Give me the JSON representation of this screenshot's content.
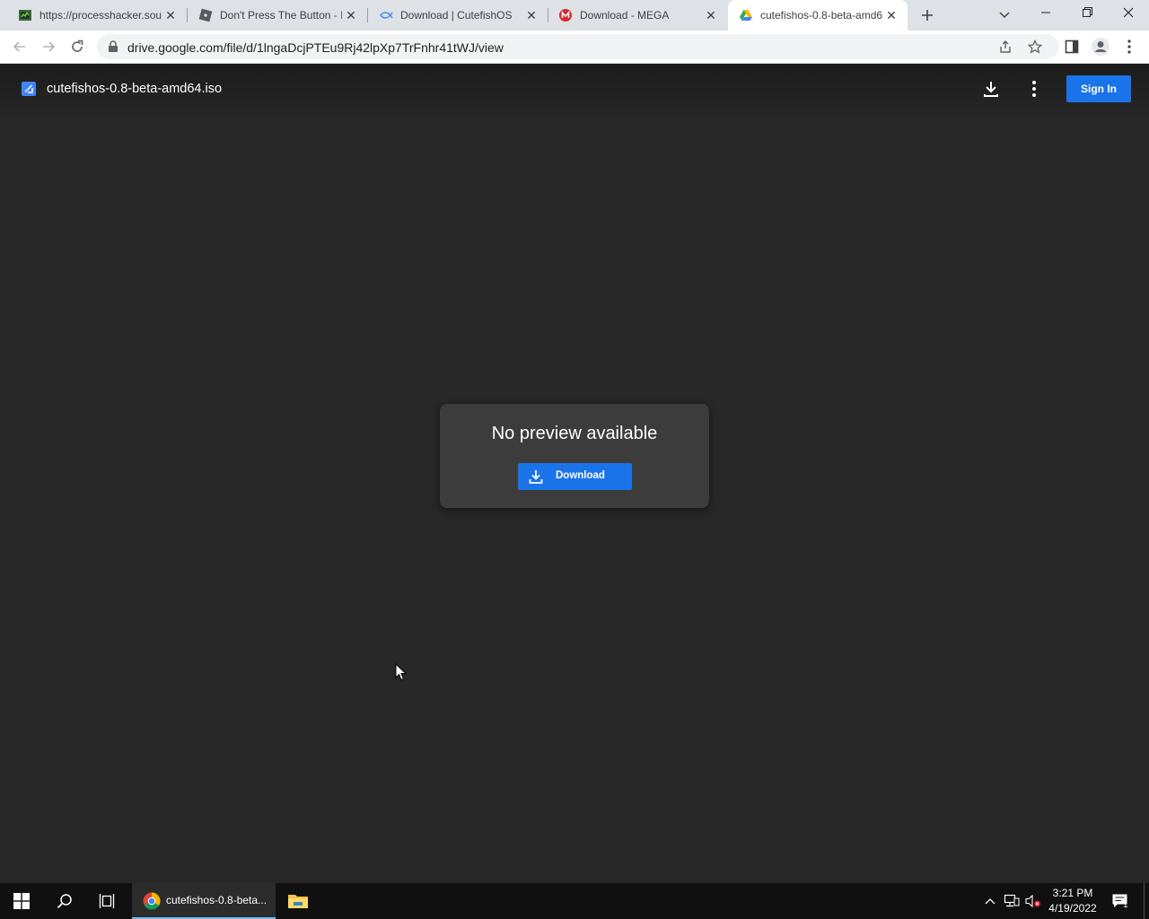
{
  "browser": {
    "tabs": [
      {
        "title": "https://processhacker.sou",
        "favicon": "processhacker-icon"
      },
      {
        "title": "Don't Press The Button - I",
        "favicon": "roblox-icon"
      },
      {
        "title": "Download | CutefishOS",
        "favicon": "cutefish-icon"
      },
      {
        "title": "Download - MEGA",
        "favicon": "mega-icon"
      },
      {
        "title": "cutefishos-0.8-beta-amd6",
        "favicon": "google-drive-icon",
        "active": true
      }
    ],
    "url": "drive.google.com/file/d/1lngaDcjPTEu9Rj42lpXp7TrFnhr41tWJ/view"
  },
  "drive": {
    "file_name": "cutefishos-0.8-beta-amd64.iso",
    "sign_in_label": "Sign In",
    "preview_message": "No preview available",
    "download_label": "Download"
  },
  "taskbar": {
    "chrome_label": "cutefishos-0.8-beta...",
    "time": "3:21 PM",
    "date": "4/19/2022",
    "notification_count": "1"
  },
  "colors": {
    "accent": "#1a73e8",
    "page_bg": "#272727",
    "card_bg": "#3c3c3c"
  }
}
